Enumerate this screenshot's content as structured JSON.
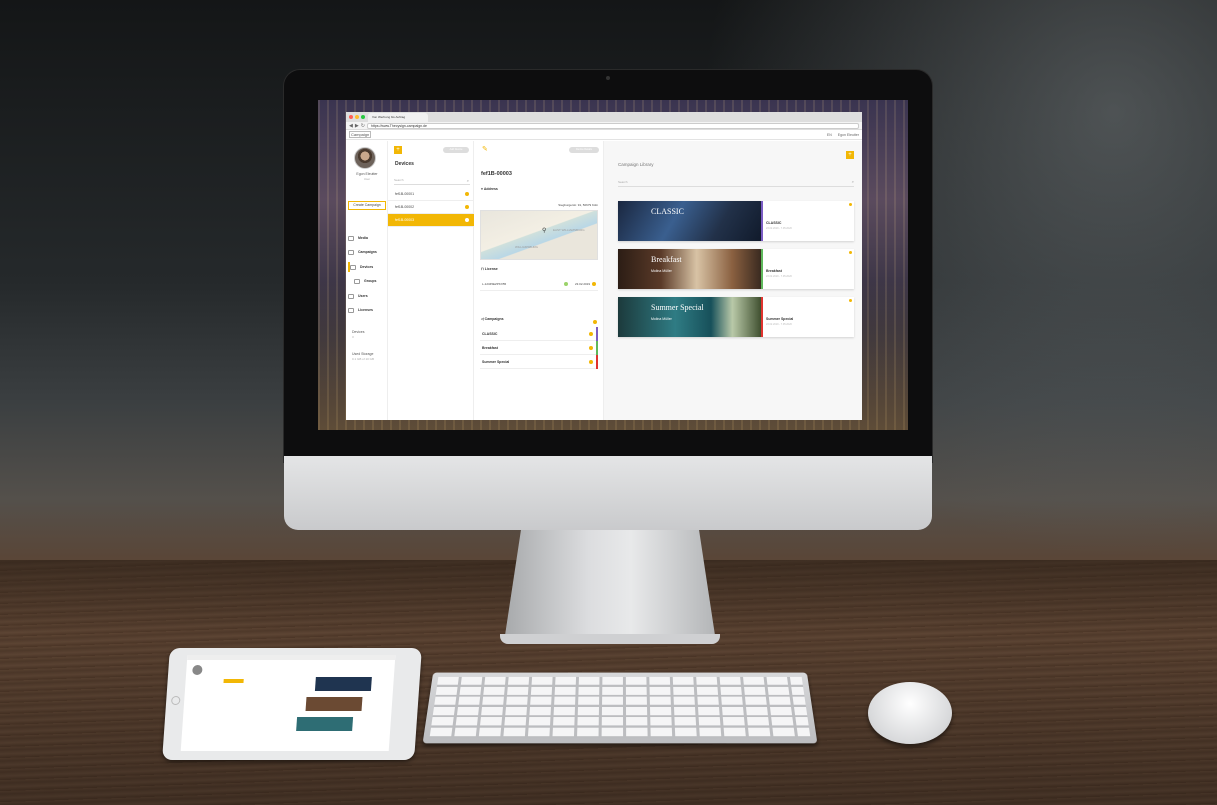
{
  "browser": {
    "tab_title": "Von Werbung bis Auftrag",
    "url": "https://www.Thecysign-campaign.de",
    "app_logo": "Campaign",
    "language": "EN",
    "top_user": "Egon Eleutter"
  },
  "sidebar": {
    "user_name": "Egon Eleutter",
    "user_role": "User",
    "create_button": "Create Campaign",
    "items": [
      {
        "label": "Media",
        "icon": "media-icon"
      },
      {
        "label": "Campaigns",
        "icon": "campaign-icon"
      },
      {
        "label": "Devices",
        "icon": "devices-icon"
      },
      {
        "label": "Groups",
        "icon": "groups-icon"
      },
      {
        "label": "Users",
        "icon": "users-icon"
      },
      {
        "label": "Licenses",
        "icon": "licenses-icon"
      }
    ],
    "stats": [
      {
        "label": "Devices",
        "value": "3"
      },
      {
        "label": "Used Storage",
        "value": "0.1 GB of 10 GB"
      }
    ]
  },
  "devices": {
    "title": "Devices",
    "pill": "Add Device",
    "search_placeholder": "Search",
    "rows": [
      "fef1B-00001",
      "fef1B-00002",
      "fef1B-00003"
    ]
  },
  "detail": {
    "pill": "Device Details",
    "title": "fef1B-00003",
    "address_label": "Address",
    "address": "Siegburgerstr. 91, 50679 Köln",
    "map_labels": [
      "EAST WILLIAMSBURG",
      "WILLIAMSBURG"
    ],
    "license_label": "License",
    "license_id": "L-12345EZPKX55",
    "license_date": "23.02.2019",
    "campaigns_label": "Campaigns",
    "campaigns": [
      {
        "name": "CLASSIC",
        "color": "#7b5cc4"
      },
      {
        "name": "Breakfast",
        "color": "#5fb85c"
      },
      {
        "name": "Summer Special",
        "color": "#e0332f"
      }
    ]
  },
  "library": {
    "title": "Campaign Library",
    "search_placeholder": "Search",
    "cards": [
      {
        "name": "CLASSIC",
        "date": "23.02.2019 - 7.05.2020",
        "overlay_title": "CLASSIC",
        "overlay_sub": "",
        "edge": "#7b5cc4"
      },
      {
        "name": "Breakfast",
        "date": "23.02.2019 - 7.05.2020",
        "overlay_title": "Breakfast",
        "overlay_sub": "Molina Müller",
        "edge": "#5fb85c"
      },
      {
        "name": "Summer Special",
        "date": "23.02.2019 - 7.05.2020",
        "overlay_title": "Summer Special",
        "overlay_sub": "Molina Müller",
        "edge": "#e0332f"
      }
    ]
  },
  "colors": {
    "accent": "#f2b705"
  }
}
